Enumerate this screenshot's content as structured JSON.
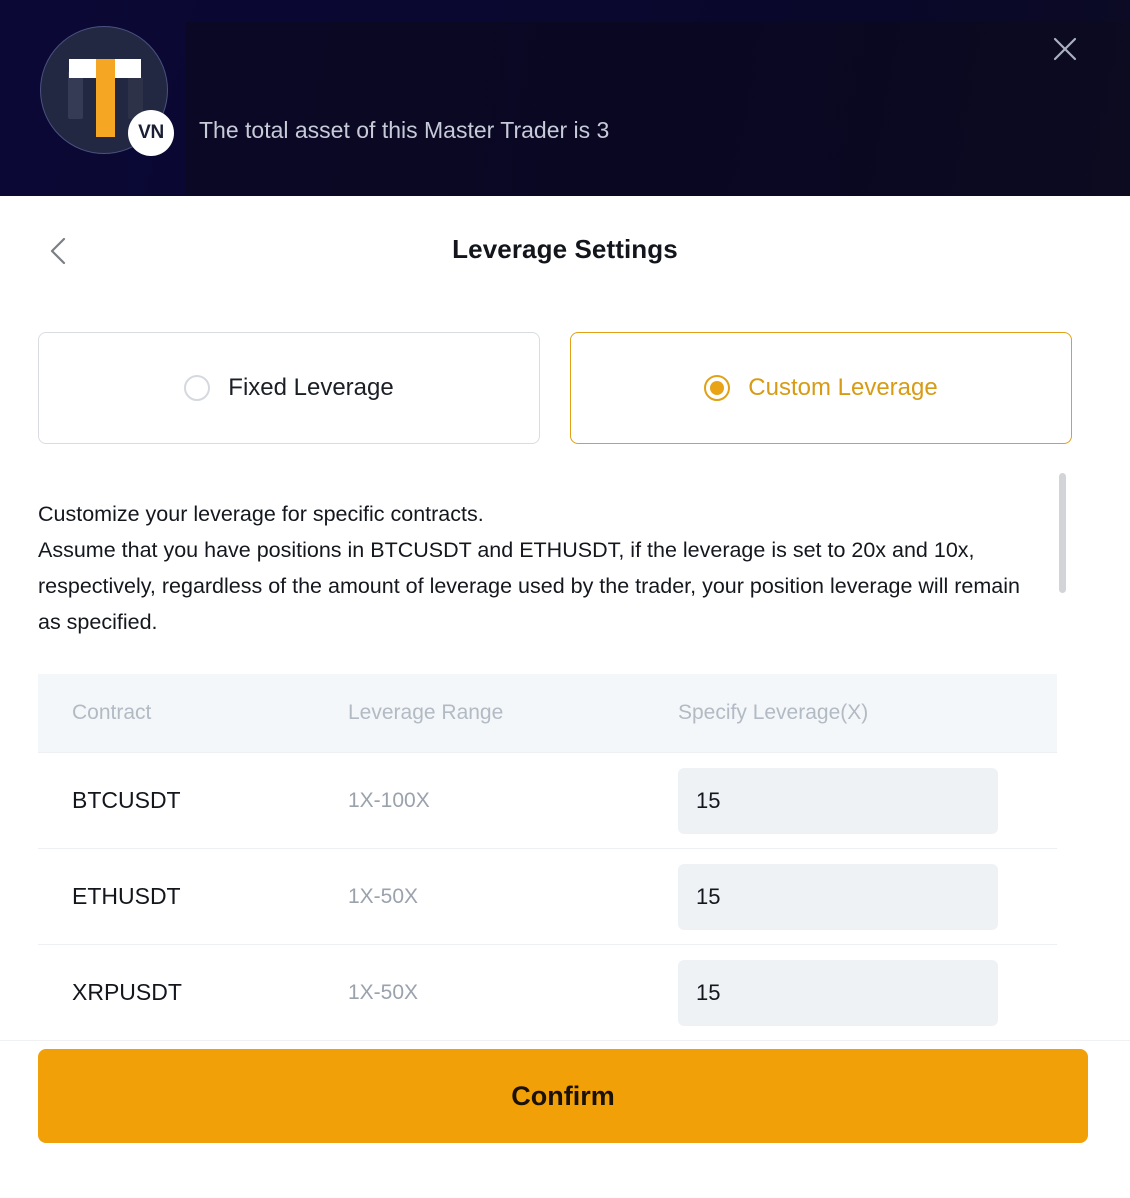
{
  "banner": {
    "avatar": {
      "logo_letter": "T",
      "badge_label": "VN"
    },
    "message": "The total asset of this Master Trader is 3",
    "close_icon": "close-icon"
  },
  "modal": {
    "title": "Leverage Settings",
    "back_icon": "chevron-left-icon",
    "modes": [
      {
        "label": "Fixed Leverage",
        "selected": false
      },
      {
        "label": "Custom Leverage",
        "selected": true
      }
    ],
    "description_line1": "Customize your leverage for specific contracts.",
    "description_line2": "Assume that you have positions in BTCUSDT and ETHUSDT, if the leverage is set to 20x and 10x, respectively, regardless of the amount of leverage used by the trader, your position leverage will remain as specified.",
    "table": {
      "columns": [
        "Contract",
        "Leverage Range",
        "Specify Leverage(X)"
      ],
      "rows": [
        {
          "contract": "BTCUSDT",
          "range": "1X-100X",
          "leverage": "15"
        },
        {
          "contract": "ETHUSDT",
          "range": "1X-50X",
          "leverage": "15"
        },
        {
          "contract": "XRPUSDT",
          "range": "1X-50X",
          "leverage": "15"
        }
      ]
    },
    "confirm_label": "Confirm"
  },
  "colors": {
    "accent": "#e8a317",
    "confirm_bg": "#f2a007",
    "banner_bg": "#0b0836",
    "input_bg": "#eff2f5",
    "table_header_bg": "#f4f7f9"
  }
}
